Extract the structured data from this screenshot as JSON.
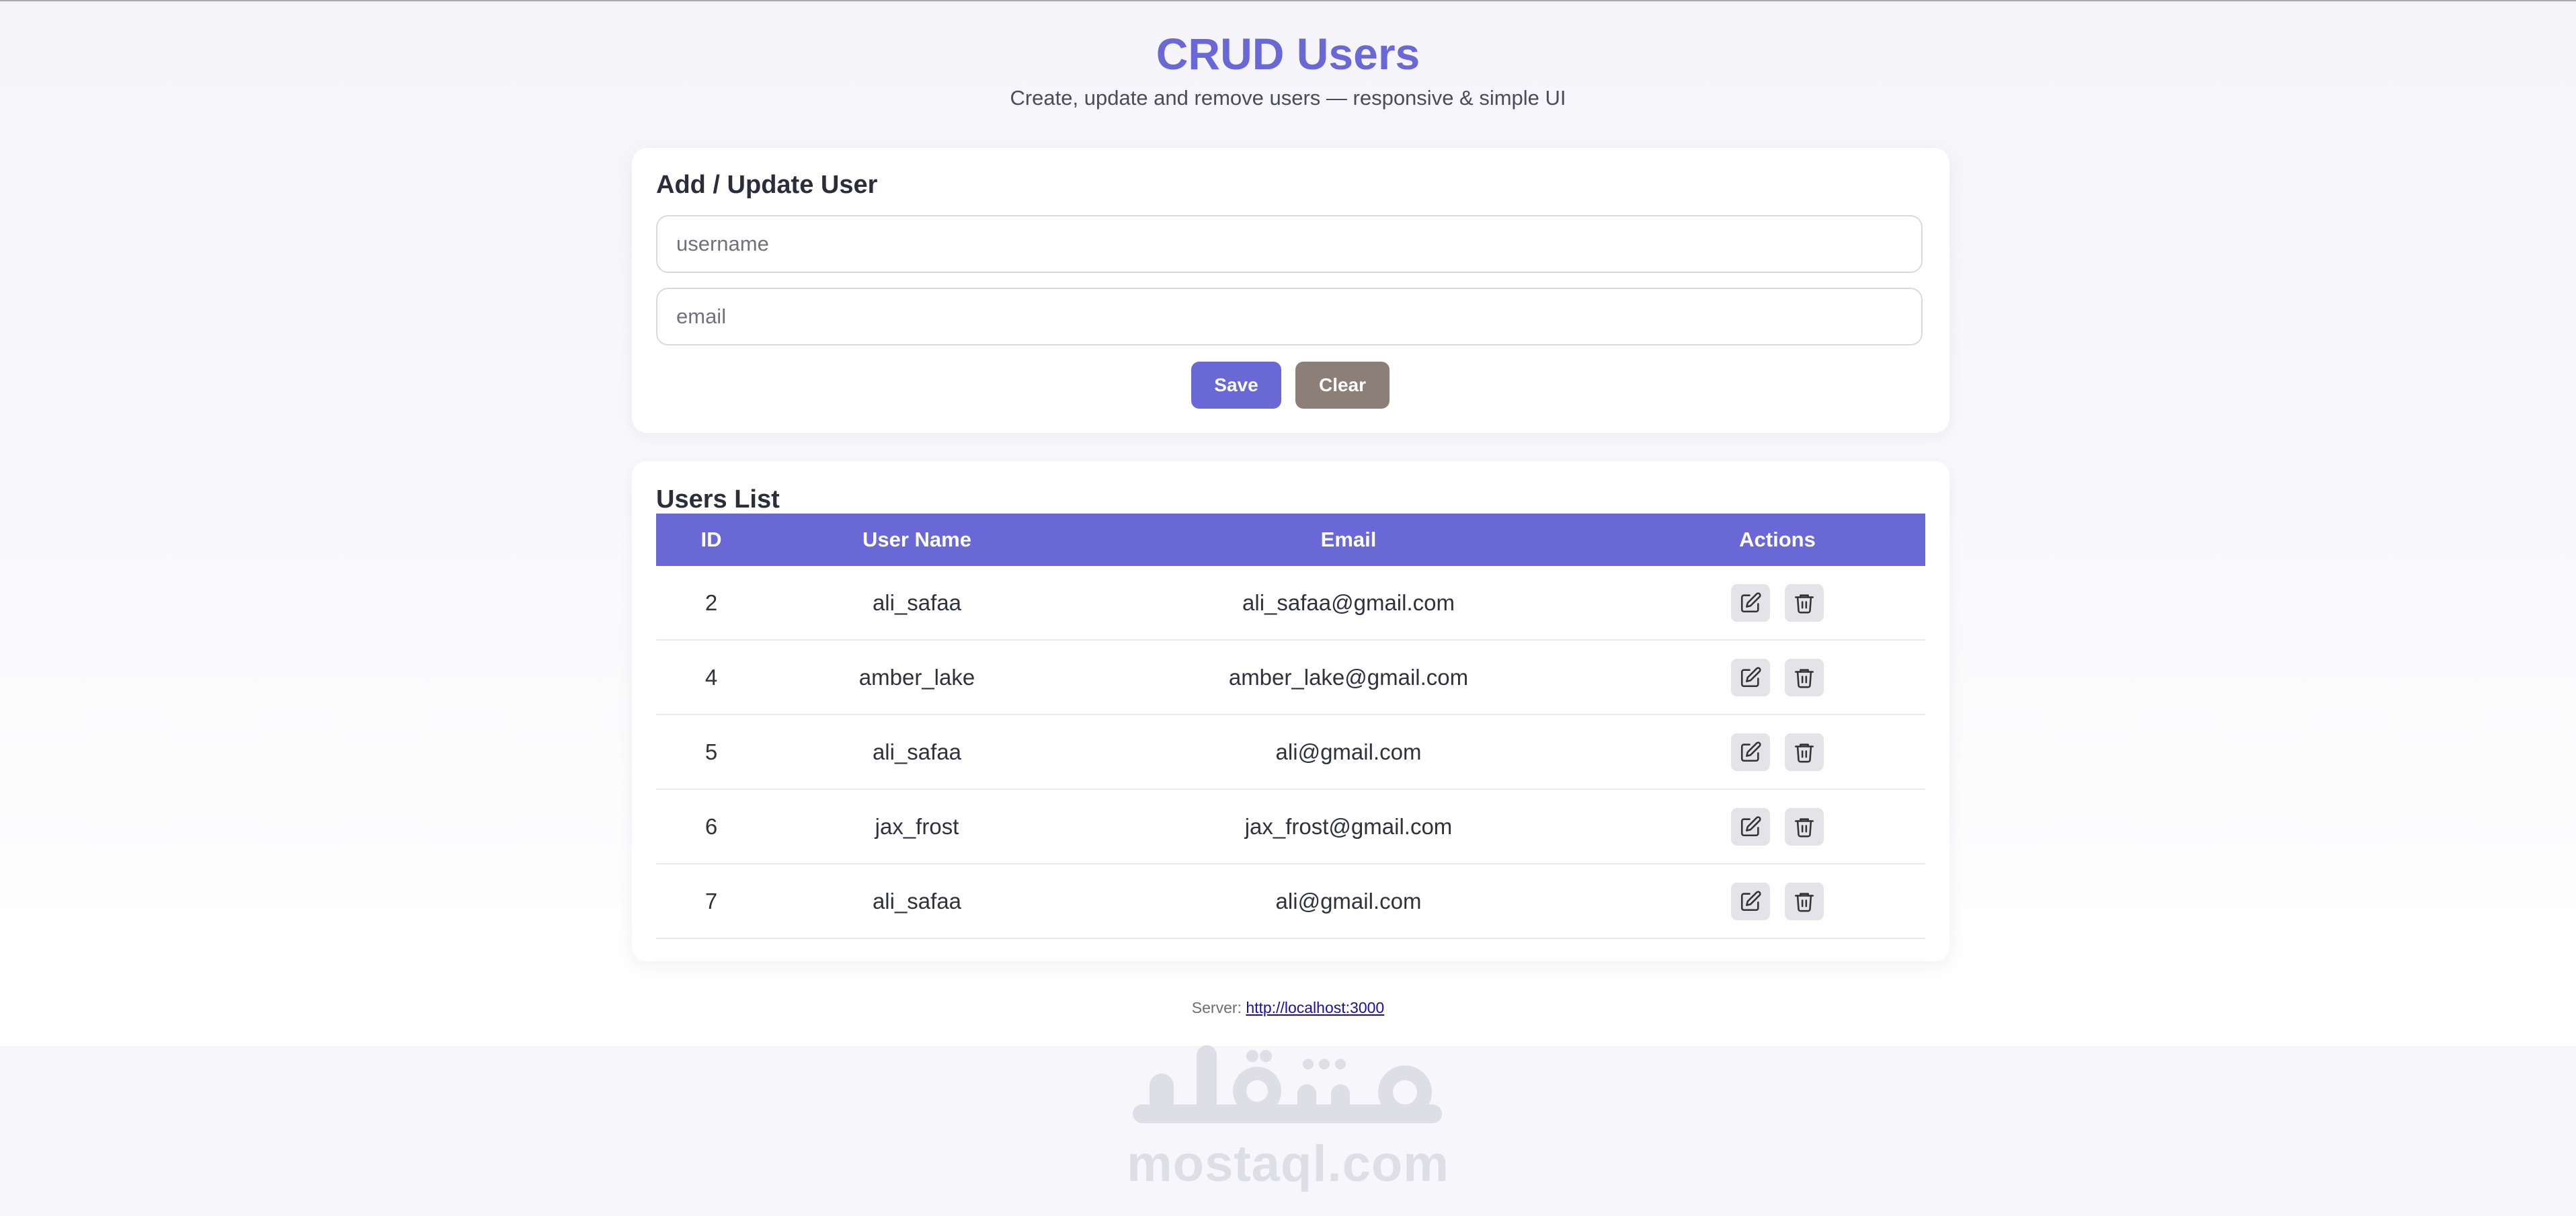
{
  "header": {
    "title": "CRUD Users",
    "subtitle": "Create, update and remove users — responsive & simple UI"
  },
  "form": {
    "title": "Add / Update User",
    "username_placeholder": "username",
    "email_placeholder": "email",
    "save_label": "Save",
    "clear_label": "Clear"
  },
  "users_list": {
    "title": "Users List",
    "columns": [
      "ID",
      "User Name",
      "Email",
      "Actions"
    ],
    "rows": [
      {
        "id": "2",
        "username": "ali_safaa",
        "email": "ali_safaa@gmail.com"
      },
      {
        "id": "4",
        "username": "amber_lake",
        "email": "amber_lake@gmail.com"
      },
      {
        "id": "5",
        "username": "ali_safaa",
        "email": "ali@gmail.com"
      },
      {
        "id": "6",
        "username": "jax_frost",
        "email": "jax_frost@gmail.com"
      },
      {
        "id": "7",
        "username": "ali_safaa",
        "email": "ali@gmail.com"
      }
    ],
    "row_actions": [
      "edit-icon",
      "trash-icon"
    ]
  },
  "footer": {
    "server_label": "Server:",
    "server_url": "http://localhost:3000"
  },
  "watermark": {
    "arabic_text": "مستقل",
    "latin_text": "mostaql.com"
  },
  "colors": {
    "accent": "#6a67d6",
    "clear_button": "#8c7f78",
    "action_button_bg": "#e4e4e8"
  }
}
